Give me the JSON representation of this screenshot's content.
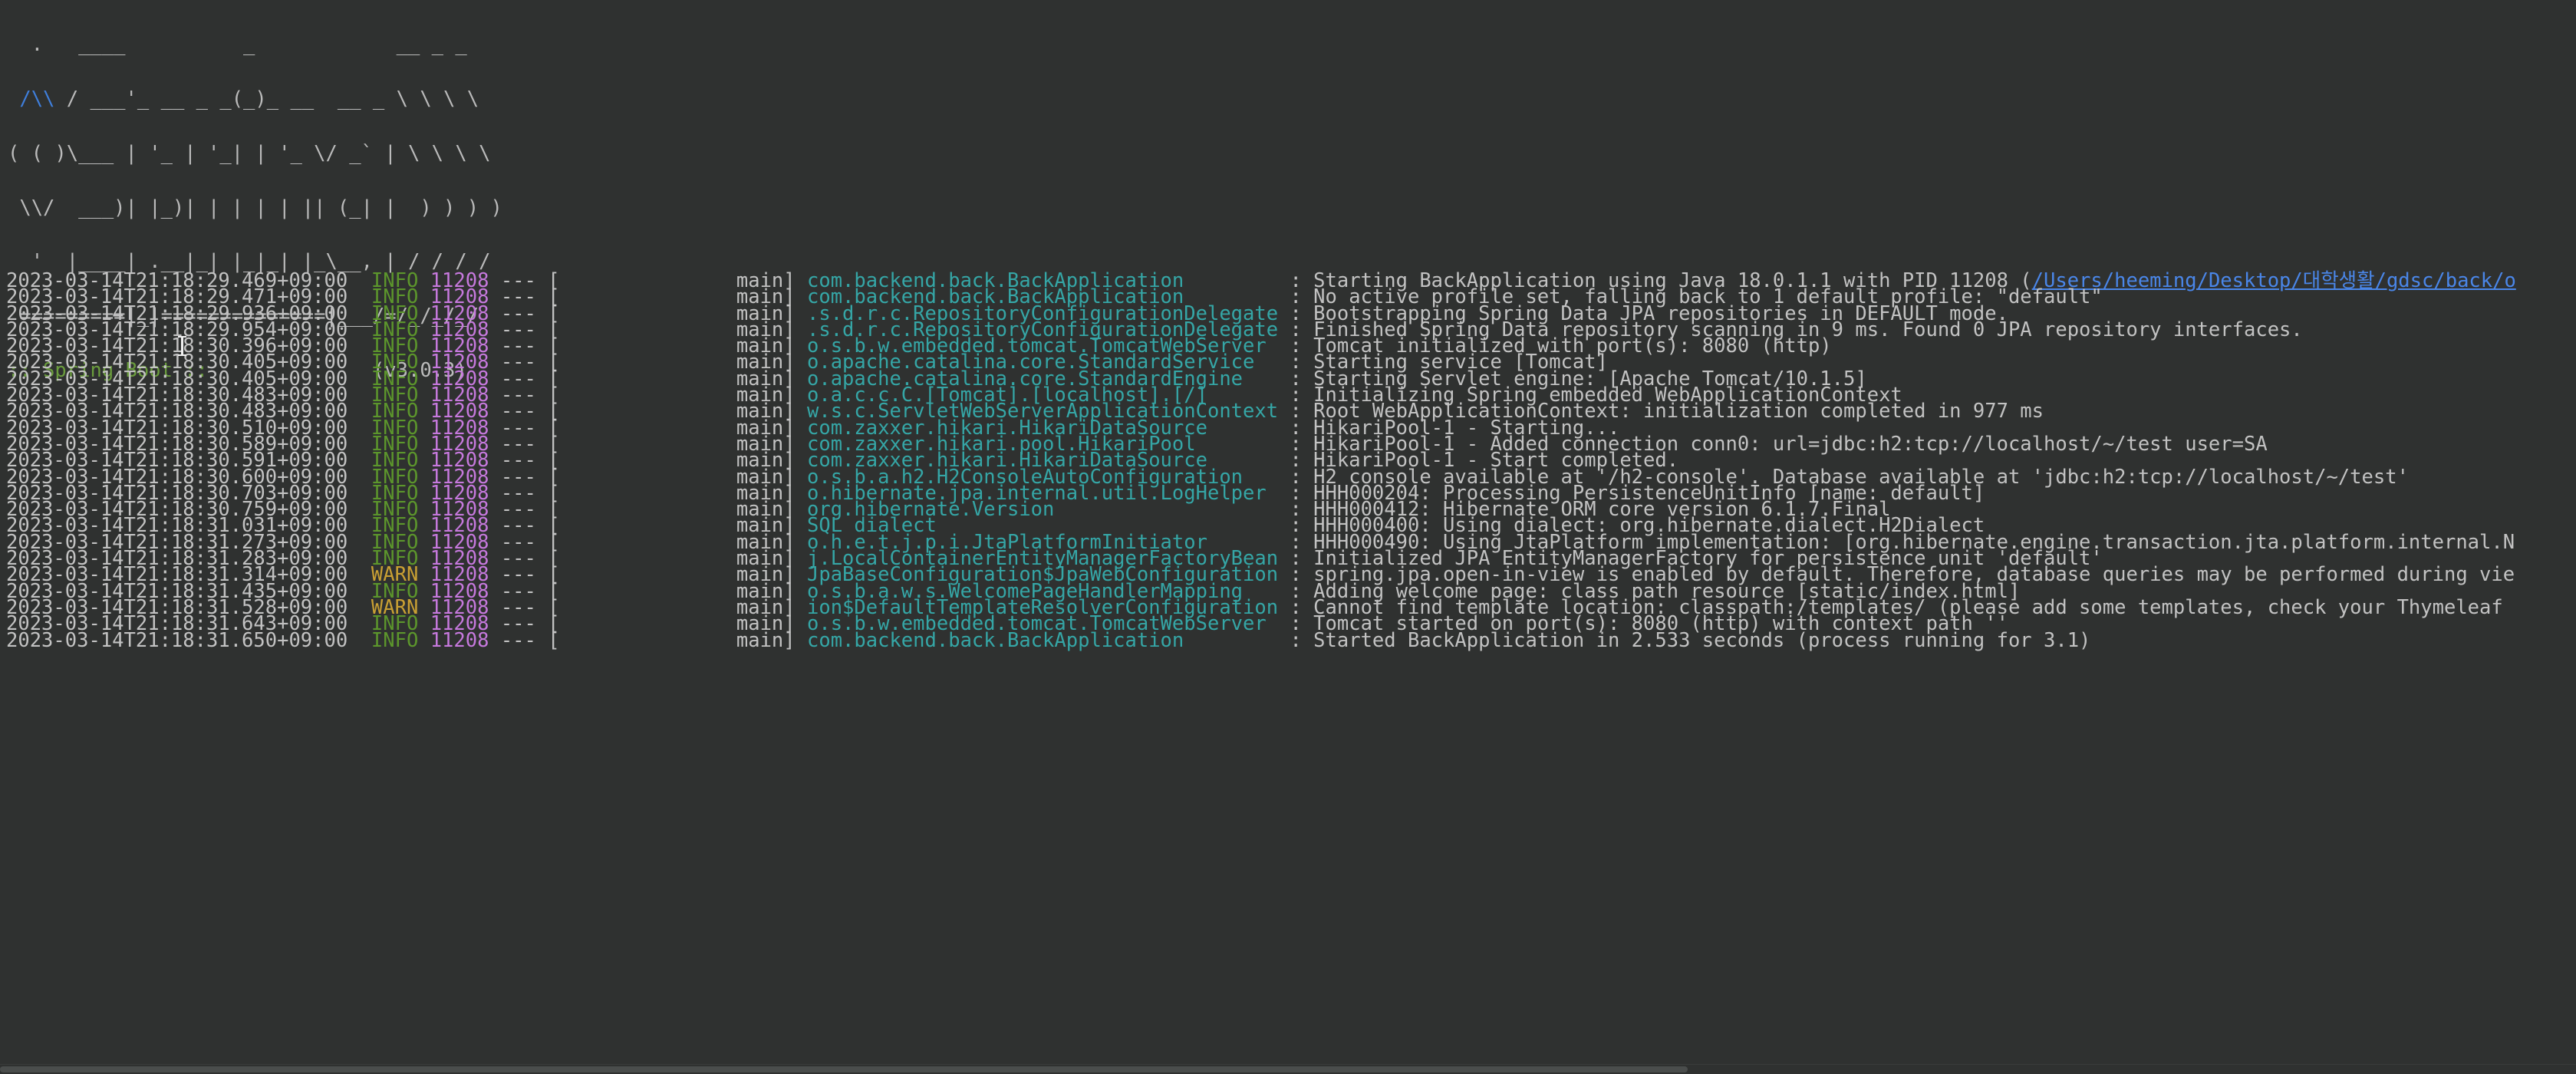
{
  "terminal": {
    "background_color": "#2f3130",
    "foreground_color": "#c2c2c2",
    "info_color": "#5c962c",
    "warn_color": "#c9a033",
    "pid_color": "#c679dd",
    "logger_color": "#35a6a6",
    "link_color": "#4a86e8"
  },
  "banner": {
    "lines": [
      "  .   ____          _            __ _ _",
      " /\\\\ / ___'_ __ _ _(_)_ __  __ _ \\ \\ \\ \\",
      "( ( )\\___ | '_ | '_| | '_ \\/ _` | \\ \\ \\ \\",
      " \\\\/  ___)| |_)| | | | | || (_| |  ) ) ) )",
      "  '  |____| .__|_| |_|_| |_\\__, | / / / /",
      " =========|_|==============|___/=/_/_/_/"
    ],
    "title": ":: Spring Boot ::",
    "version": "(v3.0.3)"
  },
  "log": {
    "pid": "11208",
    "thread": "main]",
    "dashes": "---",
    "separator": ":",
    "bracket": "[",
    "entries": [
      {
        "timestamp": "2023-03-14T21:18:29.469+09:00",
        "level": "INFO",
        "logger": "com.backend.back.BackApplication",
        "message_pre": "Starting BackApplication using Java 18.0.1.1 with PID 11208 (",
        "message_link": "/Users/heeming/Desktop/대학생활/gdsc/back/o",
        "message_post": ""
      },
      {
        "timestamp": "2023-03-14T21:18:29.471+09:00",
        "level": "INFO",
        "logger": "com.backend.back.BackApplication",
        "message": "No active profile set, falling back to 1 default profile: \"default\""
      },
      {
        "timestamp": "2023-03-14T21:18:29.936+09:00",
        "level": "INFO",
        "logger": ".s.d.r.c.RepositoryConfigurationDelegate",
        "message": "Bootstrapping Spring Data JPA repositories in DEFAULT mode."
      },
      {
        "timestamp": "2023-03-14T21:18:29.954+09:00",
        "level": "INFO",
        "logger": ".s.d.r.c.RepositoryConfigurationDelegate",
        "message": "Finished Spring Data repository scanning in 9 ms. Found 0 JPA repository interfaces."
      },
      {
        "timestamp": "2023-03-14T21:18:30.396+09:00",
        "level": "INFO",
        "logger": "o.s.b.w.embedded.tomcat.TomcatWebServer",
        "message": "Tomcat initialized with port(s): 8080 (http)"
      },
      {
        "timestamp": "2023-03-14T21:18:30.405+09:00",
        "level": "INFO",
        "logger": "o.apache.catalina.core.StandardService",
        "message": "Starting service [Tomcat]"
      },
      {
        "timestamp": "2023-03-14T21:18:30.405+09:00",
        "level": "INFO",
        "logger": "o.apache.catalina.core.StandardEngine",
        "message": "Starting Servlet engine: [Apache Tomcat/10.1.5]"
      },
      {
        "timestamp": "2023-03-14T21:18:30.483+09:00",
        "level": "INFO",
        "logger": "o.a.c.c.C.[Tomcat].[localhost].[/]",
        "message": "Initializing Spring embedded WebApplicationContext"
      },
      {
        "timestamp": "2023-03-14T21:18:30.483+09:00",
        "level": "INFO",
        "logger": "w.s.c.ServletWebServerApplicationContext",
        "message": "Root WebApplicationContext: initialization completed in 977 ms"
      },
      {
        "timestamp": "2023-03-14T21:18:30.510+09:00",
        "level": "INFO",
        "logger": "com.zaxxer.hikari.HikariDataSource",
        "message": "HikariPool-1 - Starting..."
      },
      {
        "timestamp": "2023-03-14T21:18:30.589+09:00",
        "level": "INFO",
        "logger": "com.zaxxer.hikari.pool.HikariPool",
        "message": "HikariPool-1 - Added connection conn0: url=jdbc:h2:tcp://localhost/~/test user=SA"
      },
      {
        "timestamp": "2023-03-14T21:18:30.591+09:00",
        "level": "INFO",
        "logger": "com.zaxxer.hikari.HikariDataSource",
        "message": "HikariPool-1 - Start completed."
      },
      {
        "timestamp": "2023-03-14T21:18:30.600+09:00",
        "level": "INFO",
        "logger": "o.s.b.a.h2.H2ConsoleAutoConfiguration",
        "message": "H2 console available at '/h2-console'. Database available at 'jdbc:h2:tcp://localhost/~/test'"
      },
      {
        "timestamp": "2023-03-14T21:18:30.703+09:00",
        "level": "INFO",
        "logger": "o.hibernate.jpa.internal.util.LogHelper",
        "message": "HHH000204: Processing PersistenceUnitInfo [name: default]"
      },
      {
        "timestamp": "2023-03-14T21:18:30.759+09:00",
        "level": "INFO",
        "logger": "org.hibernate.Version",
        "message": "HHH000412: Hibernate ORM core version 6.1.7.Final"
      },
      {
        "timestamp": "2023-03-14T21:18:31.031+09:00",
        "level": "INFO",
        "logger": "SQL dialect",
        "message": "HHH000400: Using dialect: org.hibernate.dialect.H2Dialect"
      },
      {
        "timestamp": "2023-03-14T21:18:31.273+09:00",
        "level": "INFO",
        "logger": "o.h.e.t.j.p.i.JtaPlatformInitiator",
        "message": "HHH000490: Using JtaPlatform implementation: [org.hibernate.engine.transaction.jta.platform.internal.N"
      },
      {
        "timestamp": "2023-03-14T21:18:31.283+09:00",
        "level": "INFO",
        "logger": "j.LocalContainerEntityManagerFactoryBean",
        "message": "Initialized JPA EntityManagerFactory for persistence unit 'default'"
      },
      {
        "timestamp": "2023-03-14T21:18:31.314+09:00",
        "level": "WARN",
        "logger": "JpaBaseConfiguration$JpaWebConfiguration",
        "message": "spring.jpa.open-in-view is enabled by default. Therefore, database queries may be performed during vie"
      },
      {
        "timestamp": "2023-03-14T21:18:31.435+09:00",
        "level": "INFO",
        "logger": "o.s.b.a.w.s.WelcomePageHandlerMapping",
        "message": "Adding welcome page: class path resource [static/index.html]"
      },
      {
        "timestamp": "2023-03-14T21:18:31.528+09:00",
        "level": "WARN",
        "logger": "ion$DefaultTemplateResolverConfiguration",
        "message": "Cannot find template location: classpath:/templates/ (please add some templates, check your Thymeleaf "
      },
      {
        "timestamp": "2023-03-14T21:18:31.643+09:00",
        "level": "INFO",
        "logger": "o.s.b.w.embedded.tomcat.TomcatWebServer",
        "message": "Tomcat started on port(s): 8080 (http) with context path ''"
      },
      {
        "timestamp": "2023-03-14T21:18:31.650+09:00",
        "level": "INFO",
        "logger": "com.backend.back.BackApplication",
        "message": "Started BackApplication in 2.533 seconds (process running for 3.1)"
      }
    ]
  }
}
